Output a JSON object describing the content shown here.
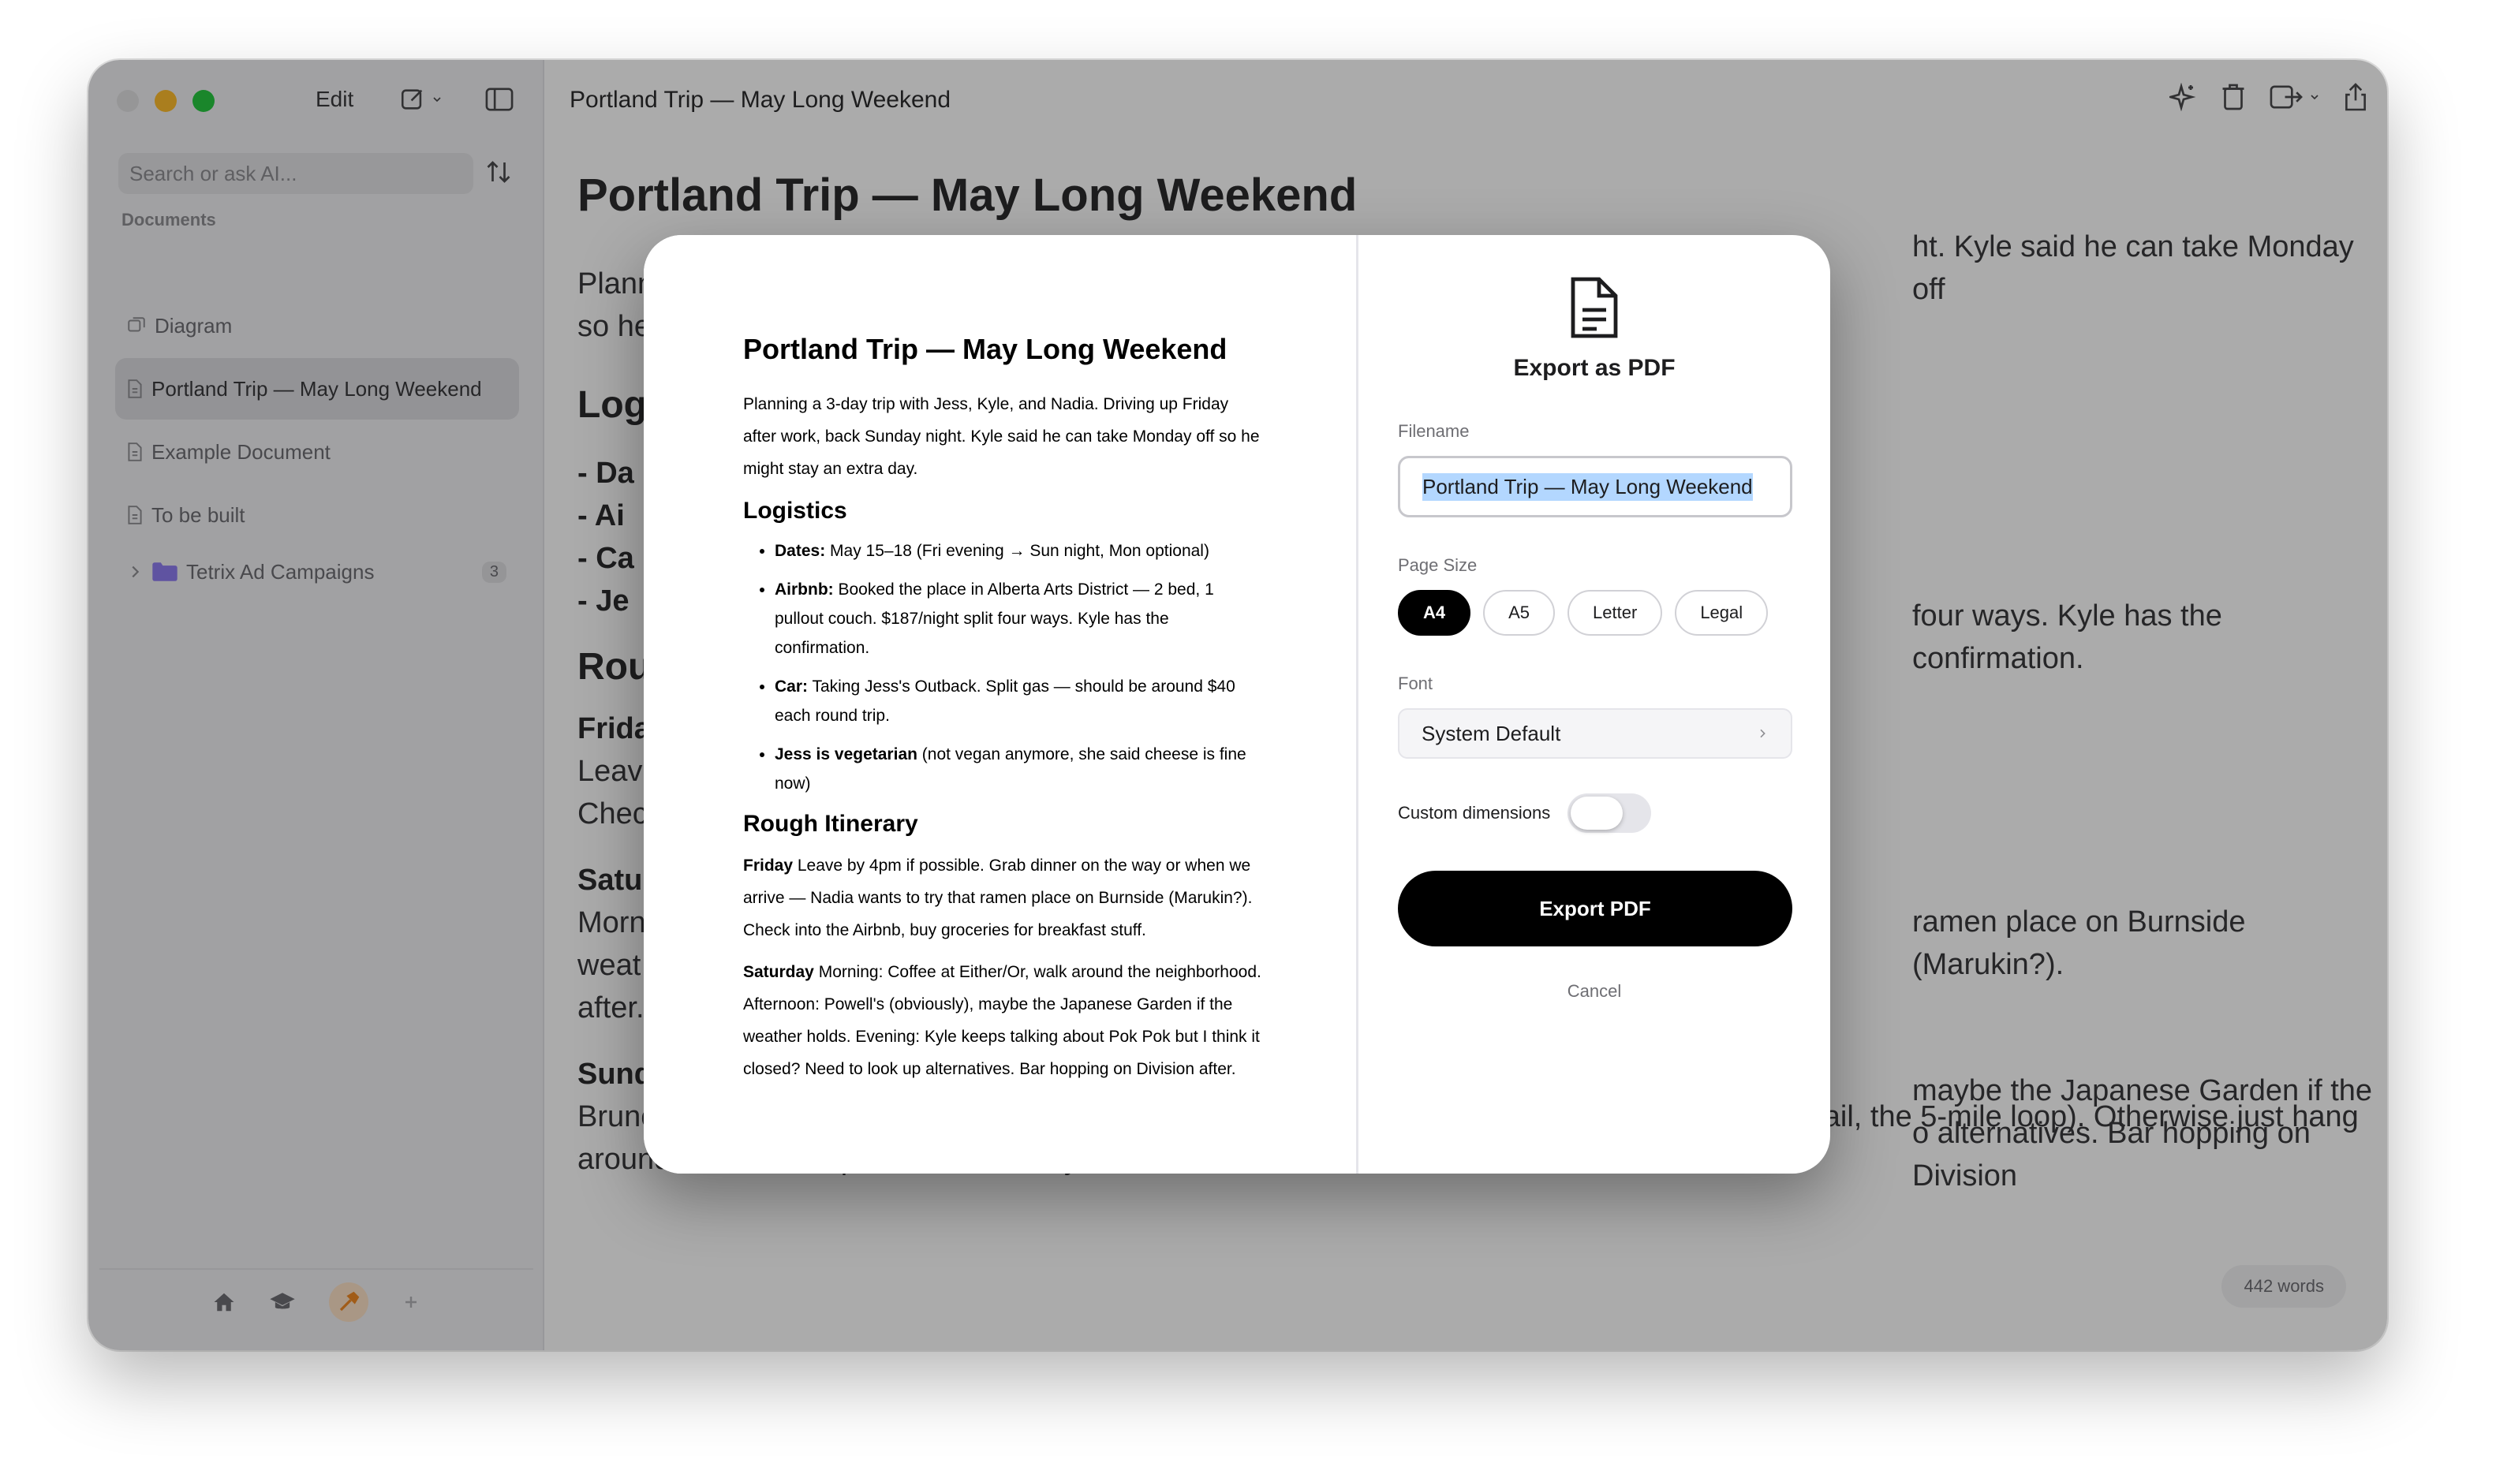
{
  "app": {
    "edit_label": "Edit",
    "search_placeholder": "Search or ask AI...",
    "documents_label": "Documents",
    "sidebar_items": [
      {
        "label": "Diagram",
        "icon": "diagram-icon"
      },
      {
        "label": "Portland Trip — May Long Weekend",
        "icon": "document-icon",
        "selected": true
      },
      {
        "label": "Example Document",
        "icon": "document-icon"
      },
      {
        "label": "To be built",
        "icon": "document-icon"
      },
      {
        "label": "Tetrix Ad Campaigns",
        "icon": "folder-icon",
        "count": "3"
      }
    ],
    "window_title": "Portland Trip — May Long Weekend",
    "word_count": "442 words",
    "accent_color": "#000000",
    "folder_color": "#8e7cf0"
  },
  "document": {
    "title": "Portland Trip — May Long Weekend",
    "intro": "Planning a 3-day trip with Jess, Kyle, and Nadia. Driving up Friday after work, back Sunday night. Kyle said he can take Monday off so he might stay an extra day.",
    "logistics_heading": "Logistics",
    "logistics": [
      {
        "label": "Dates:",
        "text": " May 15–18 (Fri evening → Sun night, Mon optional)"
      },
      {
        "label": "Airbnb:",
        "text": " Booked the place in Alberta Arts District — 2 bed, 1 pullout couch. $187/night split four ways. Kyle has the confirmation."
      },
      {
        "label": "Car:",
        "text": " Taking Jess's Outback. Split gas — should be around $40 each round trip."
      },
      {
        "label": "Jess is vegetarian",
        "text": " (not vegan anymore, she said cheese is fine now)"
      }
    ],
    "itinerary_heading": "Rough Itinerary",
    "friday_label": "Friday",
    "friday_text": " Leave by 4pm if possible. Grab dinner on the way or when we arrive — Nadia wants to try that ramen place on Burnside (Marukin?). Check into the Airbnb, buy groceries for breakfast stuff.",
    "saturday_label": "Saturday",
    "saturday_text": " Morning: Coffee at Either/Or, walk around the neighborhood. Afternoon: Powell's (obviously), maybe the Japanese Garden if the weather holds. Evening: Kyle keeps talking about Pok Pok but I think it closed? Need to look up alternatives. Bar hopping on Division after.",
    "sunday_label": "Sunday",
    "sunday_text": "Brunch somewhere — Nadia has a list. Hike in Forest Park if people are up for it (Wildwood Trail, the 5-mile loop). Otherwise just hang around, browse shops, head home by 4ish to beat traffic.",
    "bg_logistics_lines": [
      "- Da",
      "- Ai",
      "- Ca",
      "- Je"
    ],
    "bg_right": {
      "intro": "ht. Kyle said he can take Monday off",
      "airbnb": "four ways. Kyle has the confirmation.",
      "friday": "ramen place on Burnside (Marukin?).",
      "saturday1": "maybe the Japanese Garden if the",
      "saturday2": "o alternatives. Bar hopping on Division"
    },
    "bg_left": {
      "intro1": "Plann",
      "intro2": "so he",
      "logistics": "Log",
      "itinerary": "Rou",
      "friday": "Frida",
      "friday1": "Leave",
      "friday2": "Chec",
      "saturday": "Satu",
      "saturday1": "Morn",
      "saturday2": "weat",
      "saturday3": "after."
    }
  },
  "export_dialog": {
    "title": "Export as PDF",
    "filename_label": "Filename",
    "filename_value": "Portland Trip — May Long Weekend",
    "page_size_label": "Page Size",
    "page_sizes": [
      "A4",
      "A5",
      "Letter",
      "Legal"
    ],
    "selected_page_size": "A4",
    "font_label": "Font",
    "font_value": "System Default",
    "custom_dimensions_label": "Custom dimensions",
    "custom_dimensions_on": false,
    "export_button": "Export PDF",
    "cancel_button": "Cancel"
  }
}
